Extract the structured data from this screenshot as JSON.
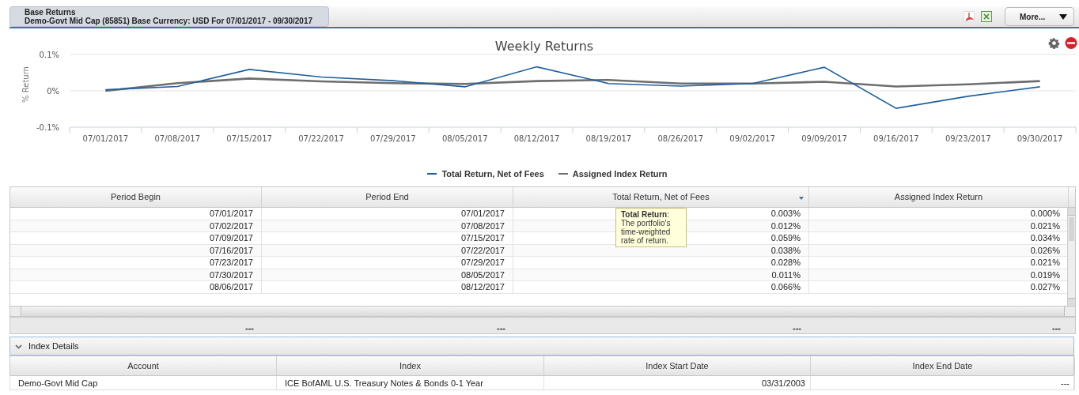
{
  "report_selector": {
    "title": "Base Returns",
    "subtitle": "Demo-Govt Mid Cap (85851) Base Currency: USD For 07/01/2017 - 09/30/2017"
  },
  "more_button": {
    "label": "More..."
  },
  "chart": {
    "chart_data": {
      "type": "line",
      "title": "Weekly Returns",
      "ylabel": "% Return",
      "categories": [
        "07/01/2017",
        "07/08/2017",
        "07/15/2017",
        "07/22/2017",
        "07/29/2017",
        "08/05/2017",
        "08/12/2017",
        "08/19/2017",
        "08/26/2017",
        "09/02/2017",
        "09/09/2017",
        "09/16/2017",
        "09/23/2017",
        "09/30/2017"
      ],
      "series": [
        {
          "name": "Total Return, Net of Fees",
          "color": "#1f5f9e",
          "values": [
            0.003,
            0.012,
            0.059,
            0.038,
            0.028,
            0.011,
            0.066,
            0.02,
            0.013,
            0.02,
            0.065,
            -0.048,
            -0.015,
            0.011
          ]
        },
        {
          "name": "Assigned Index Return",
          "color": "#6e6e6e",
          "values": [
            0.0,
            0.021,
            0.034,
            0.026,
            0.021,
            0.019,
            0.027,
            0.03,
            0.02,
            0.02,
            0.025,
            0.012,
            0.018,
            0.027
          ]
        }
      ],
      "ylim": [
        -0.1,
        0.1
      ],
      "yticks": [
        {
          "value": -0.1,
          "label": "-0.1%"
        },
        {
          "value": 0,
          "label": "0%"
        },
        {
          "value": 0.1,
          "label": "0.1%"
        }
      ]
    }
  },
  "returns_table": {
    "columns": [
      {
        "label": "Period Begin",
        "menu": false
      },
      {
        "label": "Period End",
        "menu": false
      },
      {
        "label": "Total Return, Net of Fees",
        "menu": true
      },
      {
        "label": "Assigned Index Return",
        "menu": false
      }
    ],
    "rows": [
      [
        "07/01/2017",
        "07/01/2017",
        "0.003%",
        "0.000%"
      ],
      [
        "07/02/2017",
        "07/08/2017",
        "0.012%",
        "0.021%"
      ],
      [
        "07/09/2017",
        "07/15/2017",
        "0.059%",
        "0.034%"
      ],
      [
        "07/16/2017",
        "07/22/2017",
        "0.038%",
        "0.026%"
      ],
      [
        "07/23/2017",
        "07/29/2017",
        "0.028%",
        "0.021%"
      ],
      [
        "07/30/2017",
        "08/05/2017",
        "0.011%",
        "0.019%"
      ],
      [
        "08/06/2017",
        "08/12/2017",
        "0.066%",
        "0.027%"
      ]
    ],
    "totals": [
      "---",
      "---",
      "---",
      "---"
    ],
    "tooltip": "**Total Return**: The portfolio's time-weighted rate of return."
  },
  "index_details": {
    "title": "Index Details",
    "expanded": true,
    "columns": [
      "Account",
      "Index",
      "Index Start Date",
      "Index End Date"
    ],
    "rows": [
      [
        "Demo-Govt Mid Cap",
        "ICE BofAML U.S. Treasury Notes & Bonds 0-1 Year",
        "03/31/2003",
        "---"
      ]
    ]
  }
}
